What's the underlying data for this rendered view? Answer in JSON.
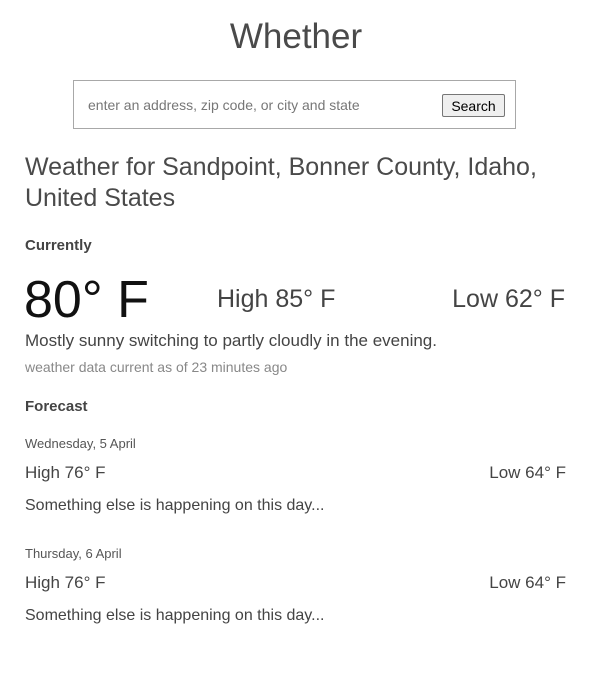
{
  "app": {
    "title": "Whether"
  },
  "search": {
    "placeholder": "enter an address, zip code, or city and state",
    "value": "",
    "button_label": "Search"
  },
  "location": {
    "title": "Weather for Sandpoint, Bonner County, Idaho, United States"
  },
  "current": {
    "section_label": "Currently",
    "temperature": "80° F",
    "high": "High 85° F",
    "low": "Low 62° F",
    "summary": "Mostly sunny switching to partly cloudly in the evening.",
    "data_age": "weather data current as of 23 minutes ago"
  },
  "forecast": {
    "section_label": "Forecast",
    "days": [
      {
        "date": "Wednesday, 5 April",
        "high": "High 76° F",
        "low": "Low 64° F",
        "summary": "Something else is happening on this day..."
      },
      {
        "date": "Thursday, 6 April",
        "high": "High 76° F",
        "low": "Low 64° F",
        "summary": "Something else is happening on this day..."
      }
    ]
  }
}
